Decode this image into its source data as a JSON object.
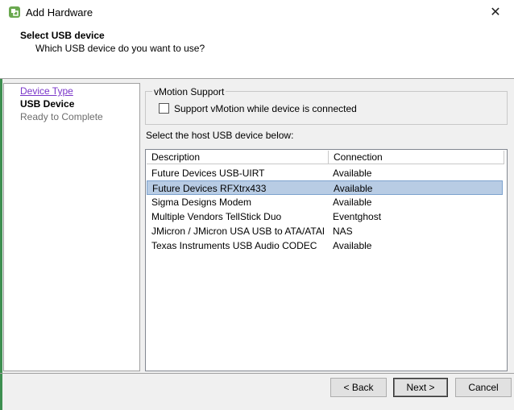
{
  "window": {
    "title": "Add Hardware"
  },
  "header": {
    "title": "Select USB device",
    "subtitle": "Which USB device do you want to use?"
  },
  "steps": [
    {
      "label": "Device Type",
      "state": "link"
    },
    {
      "label": "USB Device",
      "state": "current"
    },
    {
      "label": "Ready to Complete",
      "state": "future"
    }
  ],
  "vmotion": {
    "group_title": "vMotion Support",
    "checkbox_label": "Support vMotion while device is connected",
    "checked": false
  },
  "device_list": {
    "label": "Select the host USB device below:",
    "columns": [
      "Description",
      "Connection"
    ],
    "rows": [
      {
        "description": "Future Devices USB-UIRT",
        "connection": "Available"
      },
      {
        "description": "Future Devices RFXtrx433",
        "connection": "Available"
      },
      {
        "description": "Sigma Designs Modem",
        "connection": "Available"
      },
      {
        "description": "Multiple Vendors TellStick Duo",
        "connection": "Eventghost"
      },
      {
        "description": "JMicron / JMicron USA USB to ATA/ATAPI...",
        "connection": "NAS"
      },
      {
        "description": "Texas Instruments USB Audio CODEC",
        "connection": "Available"
      }
    ],
    "selected_index": 1
  },
  "buttons": {
    "back": "< Back",
    "next": "Next >",
    "cancel": "Cancel"
  },
  "icons": {
    "app": "vsphere-hardware-icon",
    "close": "close-icon"
  },
  "colors": {
    "selection": "#b8cce4",
    "link": "#7a36c9"
  }
}
